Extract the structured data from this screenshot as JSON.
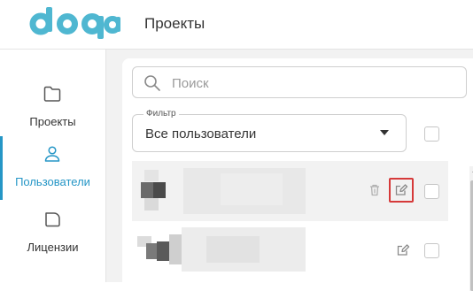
{
  "app": {
    "logo_text": "doqa",
    "logo_color": "#4fb7d1",
    "page_title": "Проекты"
  },
  "sidebar": {
    "accent_color": "#2596c6",
    "items": [
      {
        "label": "Проекты",
        "icon": "folder-icon",
        "active": false
      },
      {
        "label": "Пользователи",
        "icon": "user-icon",
        "active": true
      },
      {
        "label": "Лицензии",
        "icon": "license-icon",
        "active": false
      }
    ]
  },
  "search": {
    "placeholder": "Поиск",
    "value": ""
  },
  "filter": {
    "label": "Фильтр",
    "selected": "Все пользователи"
  },
  "rows": [
    {
      "name_redacted": true,
      "actions": [
        "trash-icon",
        "edit-icon"
      ],
      "edit_highlighted": true,
      "selected": false
    },
    {
      "name_redacted": true,
      "actions": [
        "edit-icon"
      ],
      "edit_highlighted": false,
      "selected": false
    }
  ],
  "highlight_color": "#d63a3a"
}
